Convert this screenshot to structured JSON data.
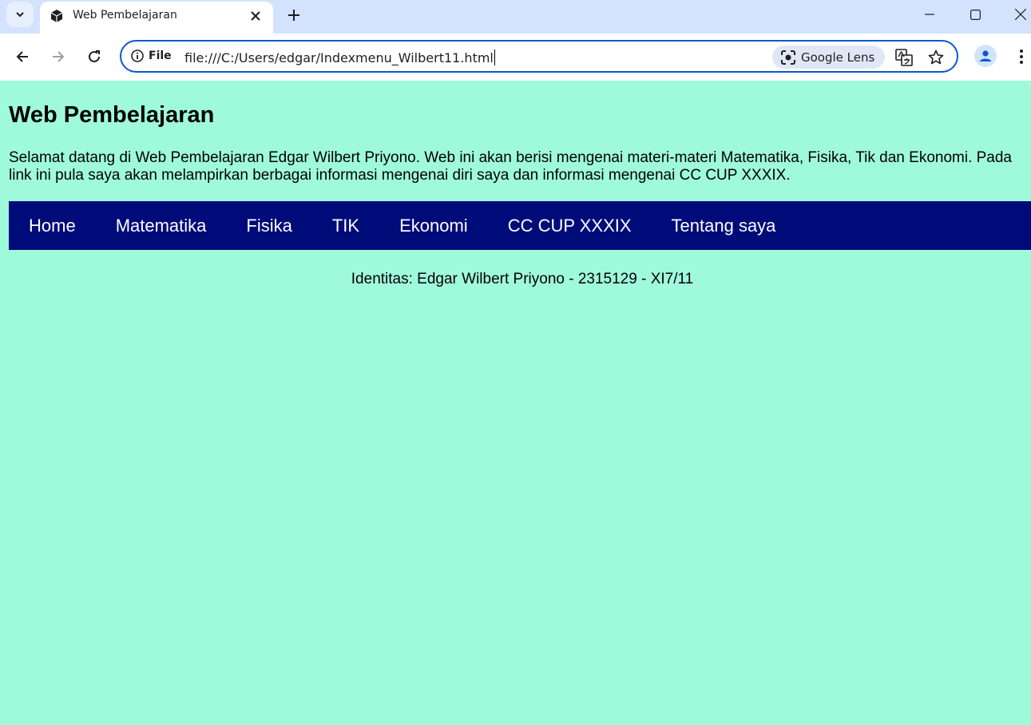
{
  "browser": {
    "tab_title": "Web Pembelajaran",
    "site_info_label": "File",
    "url": "file:///C:/Users/edgar/Indexmenu_Wilbert11.html",
    "lens_label": "Google Lens"
  },
  "page": {
    "heading": "Web Pembelajaran",
    "intro": "Selamat datang di Web Pembelajaran Edgar Wilbert Priyono. Web ini akan berisi mengenai materi-materi Matematika, Fisika, Tik dan Ekonomi. Pada link ini pula saya akan melampirkan berbagai informasi mengenai diri saya dan informasi mengenai CC CUP XXXIX.",
    "nav": [
      "Home",
      "Matematika",
      "Fisika",
      "TIK",
      "Ekonomi",
      "CC CUP XXXIX",
      "Tentang saya"
    ],
    "identity": "Identitas: Edgar Wilbert Priyono - 2315129 - XI7/11"
  },
  "colors": {
    "page_bg": "#9ffadc",
    "navbar_bg": "#000b7a",
    "tabstrip_bg": "#d3e3fd",
    "omnibox_border": "#0b57d0"
  }
}
